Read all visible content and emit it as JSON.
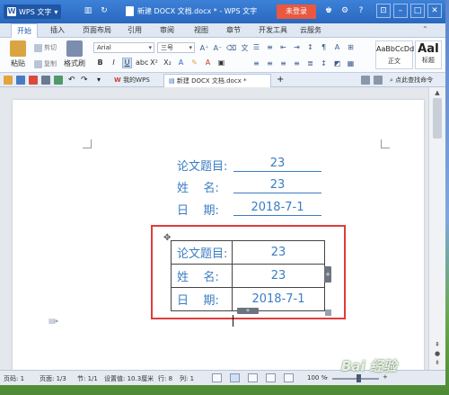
{
  "app": {
    "menu_label": "WPS 文字",
    "window_title": "新建 DOCX 文档.docx * - WPS 文字",
    "login_button": "未登录"
  },
  "tabs": [
    "开始",
    "插入",
    "页面布局",
    "引用",
    "审阅",
    "视图",
    "章节",
    "开发工具",
    "云服务"
  ],
  "ribbon": {
    "paste": "粘贴",
    "cut": "剪切",
    "copy": "复制",
    "format_painter": "格式刷",
    "font_name": "Arial",
    "font_size": "三号",
    "styles": [
      {
        "preview": "AaBbCcDd",
        "name": "正文"
      },
      {
        "preview": "AaI",
        "name": "标题"
      }
    ]
  },
  "doc_tabs": [
    "我的WPS",
    "新建 DOCX 文档.docx *"
  ],
  "command_search": "点此查找命令",
  "document": {
    "fields": [
      {
        "label": "论文题目:",
        "value": "23"
      },
      {
        "label": "姓    名:",
        "value": "23"
      },
      {
        "label": "日    期:",
        "value": "2018-7-1"
      }
    ],
    "table": [
      {
        "label": "论文题目:",
        "value": "23"
      },
      {
        "label": "姓    名:",
        "value": "23"
      },
      {
        "label": "日    期:",
        "value": "2018-7-1"
      }
    ]
  },
  "statusbar": {
    "page_num": "页码: 1",
    "page_count": "页面: 1/3",
    "section": "节: 1/1",
    "position": "设置值: 10.3厘米",
    "row": "行: 8",
    "col": "列: 1",
    "zoom": "100 %"
  },
  "watermark": "Bai 经验",
  "colors": {
    "accent": "#2a68bd",
    "login": "#e9583f",
    "field_text": "#3b7dc2",
    "highlight": "#e03c3c"
  }
}
